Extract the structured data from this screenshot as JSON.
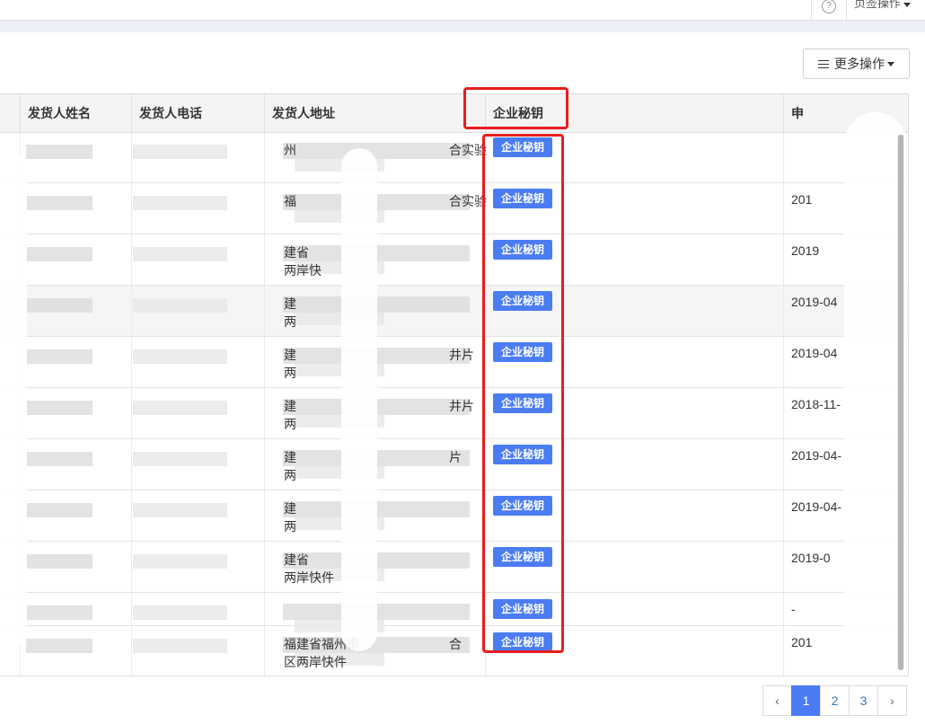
{
  "topbar": {
    "help_icon": "?",
    "page_operation": "页签操作"
  },
  "toolbar": {
    "more_label": "更多操作"
  },
  "table": {
    "headers": [
      "发货人姓名",
      "发货人电话",
      "发货人地址",
      "企业秘钥",
      "申"
    ],
    "key_button_label": "企业秘钥",
    "rows": [
      {
        "addr1": "州",
        "addr1b": "合实验",
        "addr2": "",
        "date": ""
      },
      {
        "addr1": "福",
        "addr1b": "合实验",
        "addr2": "",
        "date": "201"
      },
      {
        "addr1": "建省",
        "addr1b": "",
        "addr2": "两岸快",
        "date": "2019"
      },
      {
        "addr1": "建",
        "addr1b": "",
        "addr2": "两",
        "date": "2019-04"
      },
      {
        "addr1": "建",
        "addr1b": "井片",
        "addr2": "两",
        "date": "2019-04"
      },
      {
        "addr1": "建",
        "addr1b": "井片",
        "addr2": "两",
        "date": "2018-11-"
      },
      {
        "addr1": "建",
        "addr1b": "片",
        "addr2": "两",
        "date": "2019-04-"
      },
      {
        "addr1": "建",
        "addr1b": "",
        "addr2": "两",
        "date": "2019-04-"
      },
      {
        "addr1": "建省",
        "addr1b": "",
        "addr2": "两岸快件",
        "date": "2019-0"
      },
      {
        "addr1": "",
        "addr1b": "",
        "addr2": "",
        "date": "-"
      },
      {
        "addr1": "福建省福州市",
        "addr1b": "合",
        "addr2": "区两岸快件",
        "date": "201"
      }
    ]
  },
  "pagination": {
    "prev": "‹",
    "pages": [
      "1",
      "2",
      "3"
    ],
    "next": "›",
    "current": "1"
  },
  "colors": {
    "accent": "#4b7cf3",
    "highlight": "#e81d1d"
  }
}
